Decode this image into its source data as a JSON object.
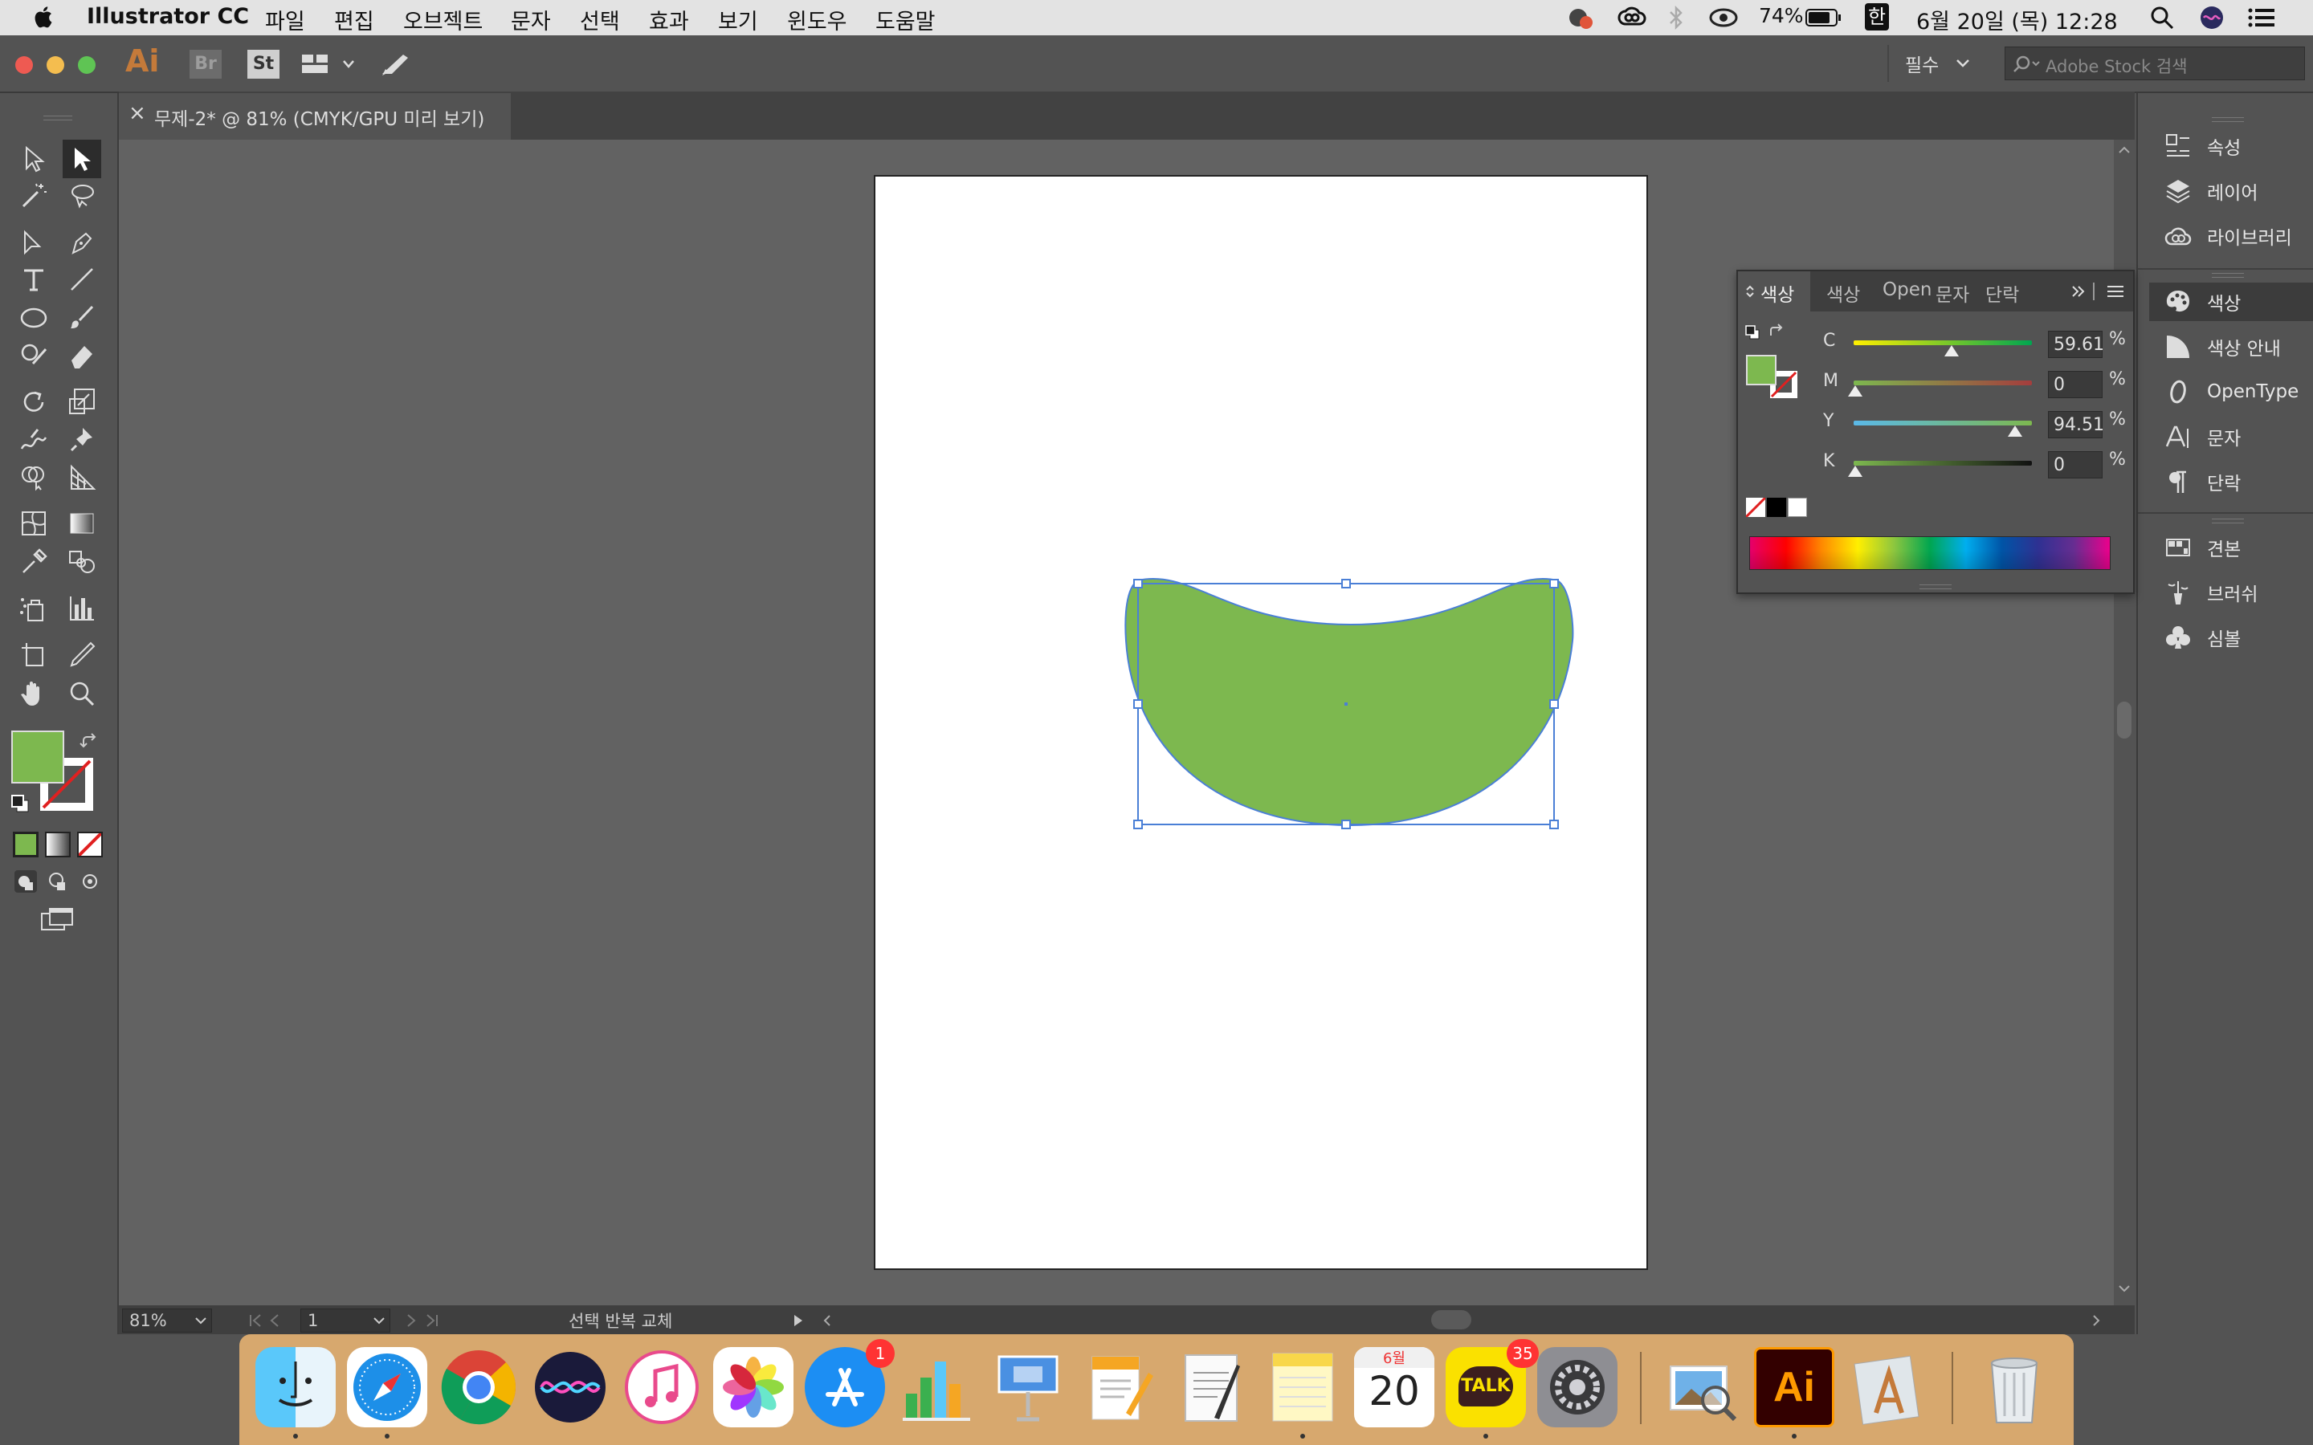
{
  "menubar": {
    "app_name": "Illustrator CC",
    "items": [
      "파일",
      "편집",
      "오브젝트",
      "문자",
      "선택",
      "효과",
      "보기",
      "윈도우",
      "도움말"
    ],
    "battery": "74%",
    "input_method": "한",
    "datetime": "6월 20일 (목) 12:28"
  },
  "appbar": {
    "ai_logo": "Ai",
    "br_label": "Br",
    "st_label": "St",
    "workspace": "필수",
    "stock_search_placeholder": "Adobe Stock 검색"
  },
  "document_tab": {
    "close": "×",
    "title": "무제-2* @ 81% (CMYK/GPU 미리 보기)"
  },
  "statusbar": {
    "zoom": "81%",
    "artboard_number": "1",
    "status_text": "선택 반복 교체"
  },
  "colors": {
    "fill": "#7db84f",
    "selection": "#4a7fd6",
    "panel_bg": "#535353"
  },
  "color_panel": {
    "tabs": [
      "색상",
      "색상",
      "Open",
      "문자",
      "단락"
    ],
    "active_tab": "색상",
    "sliders": [
      {
        "name": "C",
        "value": "59.61",
        "unit": "%"
      },
      {
        "name": "M",
        "value": "0",
        "unit": "%"
      },
      {
        "name": "Y",
        "value": "94.51",
        "unit": "%"
      },
      {
        "name": "K",
        "value": "0",
        "unit": "%"
      }
    ]
  },
  "right_dock": {
    "items": [
      {
        "label": "속성",
        "icon": "properties-icon"
      },
      {
        "label": "레이어",
        "icon": "layers-icon"
      },
      {
        "label": "라이브러리",
        "icon": "libraries-icon"
      },
      {
        "label": "색상",
        "icon": "color-palette-icon"
      },
      {
        "label": "색상 안내",
        "icon": "color-guide-icon"
      },
      {
        "label": "OpenType",
        "icon": "opentype-icon"
      },
      {
        "label": "문자",
        "icon": "character-icon"
      },
      {
        "label": "단락",
        "icon": "paragraph-icon"
      },
      {
        "label": "견본",
        "icon": "swatches-icon"
      },
      {
        "label": "브러쉬",
        "icon": "brushes-icon"
      },
      {
        "label": "심볼",
        "icon": "symbols-icon"
      }
    ]
  },
  "dock": {
    "calendar_month": "6월",
    "calendar_day": "20",
    "appstore_badge": "1",
    "kakaotalk_badge": "35",
    "kakaotalk_label": "TALK",
    "illustrator_label": "Ai"
  }
}
